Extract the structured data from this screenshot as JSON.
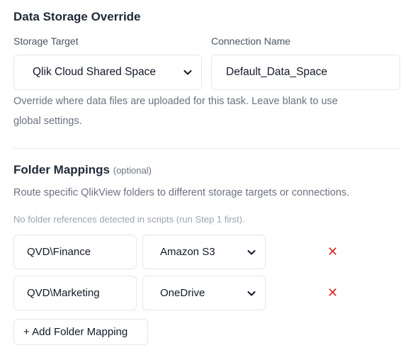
{
  "section_title": "Data Storage Override",
  "storage_target": {
    "label": "Storage Target",
    "value": "Qlik Cloud Shared Space"
  },
  "connection_name": {
    "label": "Connection Name",
    "value": "Default_Data_Space"
  },
  "help_text_line1": "Override where data files are uploaded for this task. Leave blank to use",
  "help_text_line2": "global settings.",
  "folder_mappings": {
    "title": "Folder Mappings",
    "optional": "(optional)",
    "description": "Route specific QlikView folders to different storage targets or connections.",
    "hint": "No folder references detected in scripts (run Step 1 first).",
    "rows": [
      {
        "folder": "QVD\\Finance",
        "target": "Amazon S3",
        "remove": "✕"
      },
      {
        "folder": "QVD\\Marketing",
        "target": "OneDrive",
        "remove": "✕"
      }
    ],
    "add_button": "+ Add Folder Mapping"
  }
}
